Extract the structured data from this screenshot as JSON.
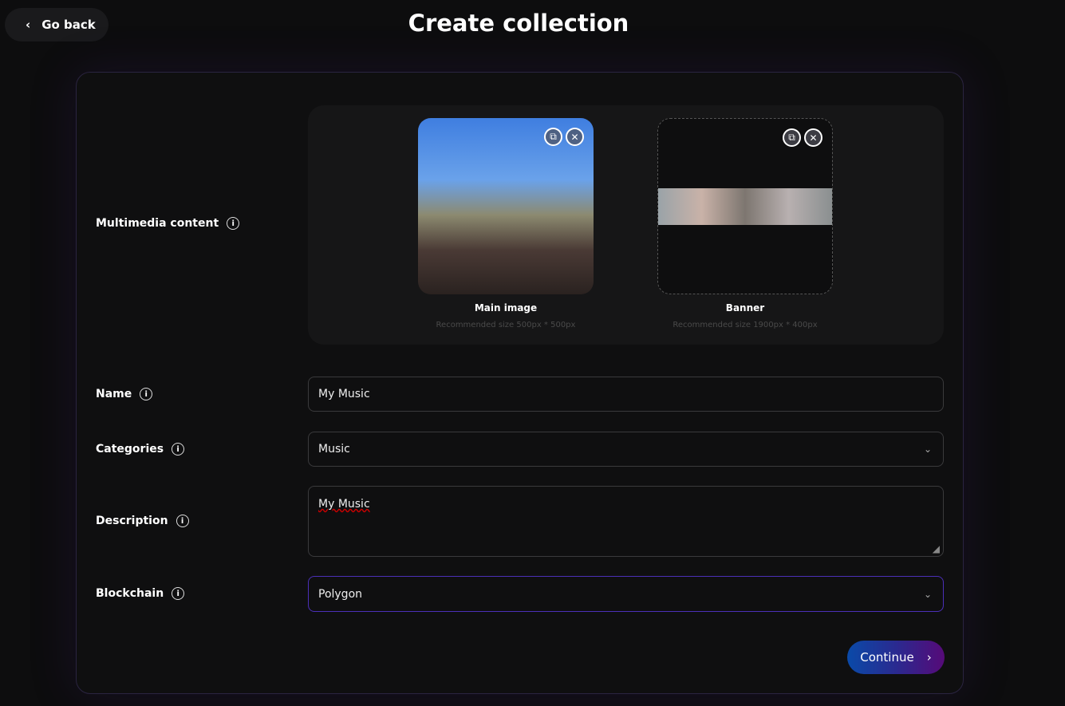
{
  "header": {
    "back_label": "Go back",
    "title": "Create collection"
  },
  "media": {
    "label": "Multimedia content",
    "main_caption": "Main image",
    "main_hint": "Recommended size 500px * 500px",
    "banner_caption": "Banner",
    "banner_hint": "Recommended size 1900px * 400px"
  },
  "form": {
    "name_label": "Name",
    "name_value": "My Music",
    "categories_label": "Categories",
    "categories_value": "Music",
    "description_label": "Description",
    "description_value": "My Music",
    "blockchain_label": "Blockchain",
    "blockchain_value": "Polygon"
  },
  "continue_label": "Continue"
}
